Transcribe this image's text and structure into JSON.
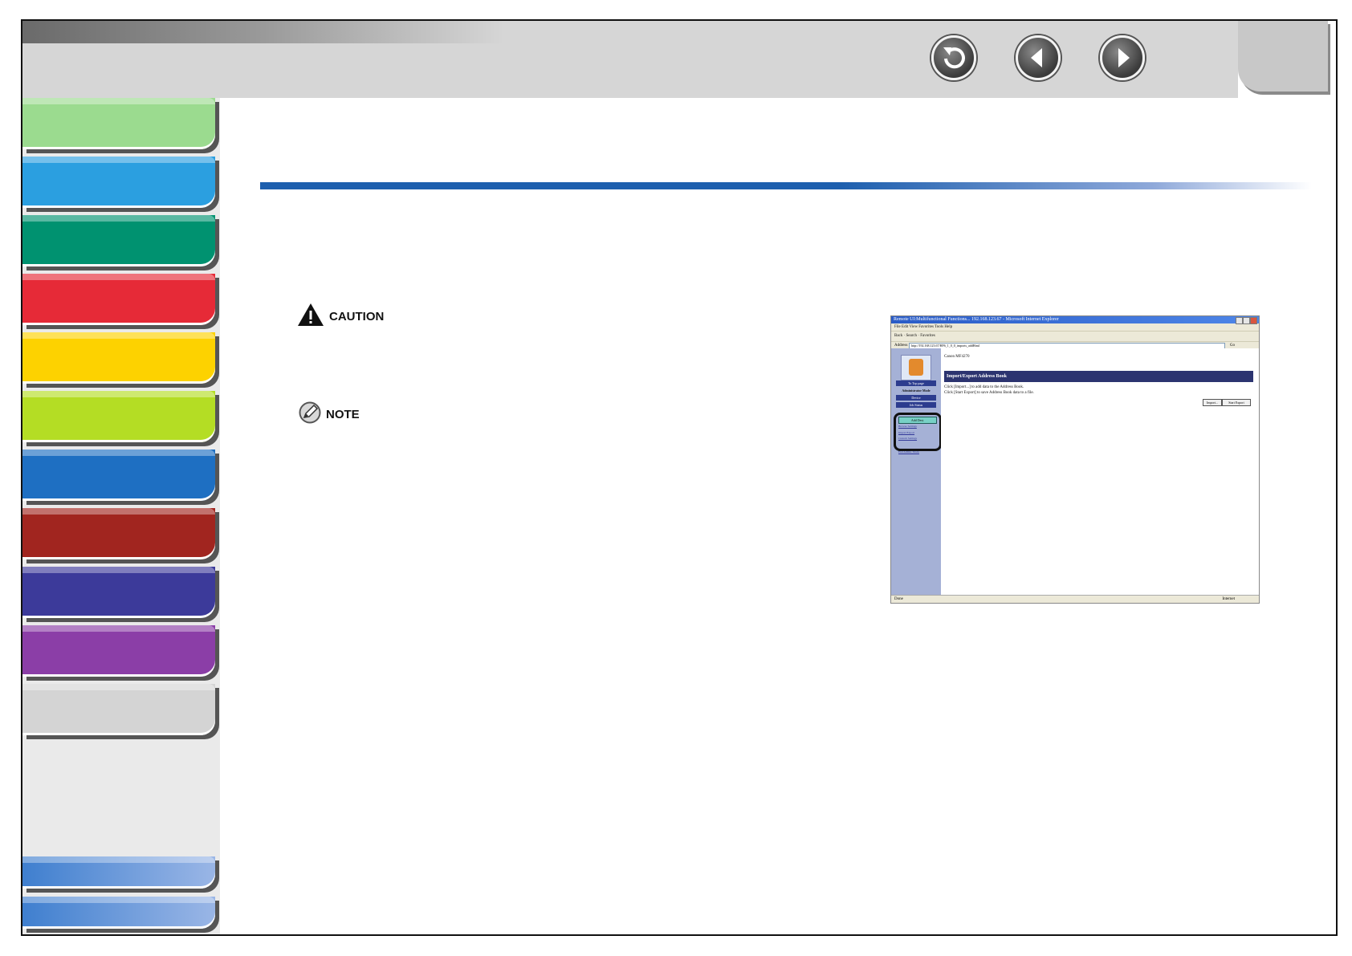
{
  "nav": {
    "back_icon": "return-arrow-icon",
    "prev_icon": "left-arrow-icon",
    "next_icon": "right-arrow-icon"
  },
  "sidebar": {
    "tabs": [
      {
        "color": "#9bdb8f"
      },
      {
        "color": "#2b9fe0"
      },
      {
        "color": "#009270"
      },
      {
        "color": "#e62a37"
      },
      {
        "color": "#fdd200"
      },
      {
        "color": "#b4dd24"
      },
      {
        "color": "#1e6fc2"
      },
      {
        "color": "#a1251f"
      },
      {
        "color": "#3c3a9a"
      },
      {
        "color": "#8b3ea7"
      },
      {
        "color": "#d4d4d4"
      }
    ]
  },
  "caution": {
    "label": "CAUTION",
    "icon": "warning-triangle-icon"
  },
  "note": {
    "label": "NOTE",
    "icon": "pencil-note-icon"
  },
  "screenshot": {
    "window_title": "Remote UI:Multifunctional Functions... 192.168.123.67 - Microsoft Internet Explorer",
    "menu": "File  Edit  View  Favorites  Tools  Help",
    "toolbar": "Back · Search · Favorites",
    "address_label": "Address",
    "address": "http://192.168.123.67/HF6_1_0_0_imports_addHtml",
    "go_label": "Go",
    "device_name": "Canon MF4270",
    "to_top_label": "To Top page",
    "admin_mode": "Administrator Mode",
    "left_buttons": [
      "Device",
      "Job Status"
    ],
    "add_dest": "Add Dest.",
    "left_links": [
      "Browse Settings",
      "Import/Export",
      "Custom Settings"
    ],
    "end_admin": "End Admin. Mode",
    "page_header": "Import/Export Address Book",
    "line1": "Click [Import...] to add data to the Address Book.",
    "line2": "Click [Start Export] to save Address Book data to a file.",
    "import_btn": "Import...",
    "export_btn": "Start Export",
    "status_left": "Done",
    "status_right": "Internet"
  }
}
